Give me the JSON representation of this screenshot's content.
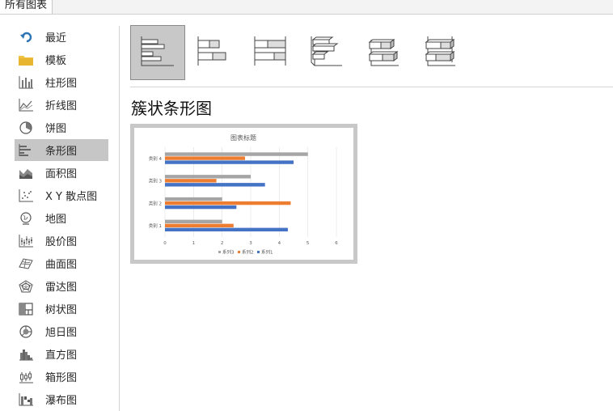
{
  "tab": {
    "label": "所有图表"
  },
  "sidebar": {
    "items": [
      {
        "label": "最近",
        "icon": "undo-arrow-icon"
      },
      {
        "label": "模板",
        "icon": "folder-icon"
      },
      {
        "label": "柱形图",
        "icon": "column-chart-icon"
      },
      {
        "label": "折线图",
        "icon": "line-chart-icon"
      },
      {
        "label": "饼图",
        "icon": "pie-chart-icon"
      },
      {
        "label": "条形图",
        "icon": "bar-chart-icon"
      },
      {
        "label": "面积图",
        "icon": "area-chart-icon"
      },
      {
        "label": "X Y 散点图",
        "icon": "scatter-chart-icon"
      },
      {
        "label": "地图",
        "icon": "globe-icon"
      },
      {
        "label": "股价图",
        "icon": "stock-chart-icon"
      },
      {
        "label": "曲面图",
        "icon": "surface-chart-icon"
      },
      {
        "label": "雷达图",
        "icon": "radar-chart-icon"
      },
      {
        "label": "树状图",
        "icon": "treemap-icon"
      },
      {
        "label": "旭日图",
        "icon": "sunburst-icon"
      },
      {
        "label": "直方图",
        "icon": "histogram-icon"
      },
      {
        "label": "箱形图",
        "icon": "box-whisker-icon"
      },
      {
        "label": "瀑布图",
        "icon": "waterfall-icon"
      }
    ],
    "selected": "条形图"
  },
  "subtypes": [
    "clustered-bar-icon",
    "stacked-bar-icon",
    "100-stacked-bar-icon",
    "3d-clustered-bar-icon",
    "3d-stacked-bar-icon",
    "3d-100-stacked-bar-icon"
  ],
  "chart_title_heading": "簇状条形图",
  "colors": {
    "series1": "#4472c4",
    "series2": "#ed7d31",
    "series3": "#a5a5a5",
    "selected": "#c6c6c6"
  },
  "chart_data": {
    "type": "bar",
    "orientation": "horizontal",
    "title": "图表标题",
    "categories": [
      "类别 1",
      "类别 2",
      "类别 3",
      "类别 4"
    ],
    "series": [
      {
        "name": "系列1",
        "values": [
          4.3,
          2.5,
          3.5,
          4.5
        ]
      },
      {
        "name": "系列2",
        "values": [
          2.4,
          4.4,
          1.8,
          2.8
        ]
      },
      {
        "name": "系列3",
        "values": [
          2,
          2,
          3,
          5
        ]
      }
    ],
    "xlim": [
      0,
      6
    ],
    "xticks": [
      "0",
      "1",
      "2",
      "3",
      "4",
      "5",
      "6"
    ],
    "legend": [
      "系列3",
      "系列2",
      "系列1"
    ],
    "legend_position": "bottom",
    "grid": true
  }
}
